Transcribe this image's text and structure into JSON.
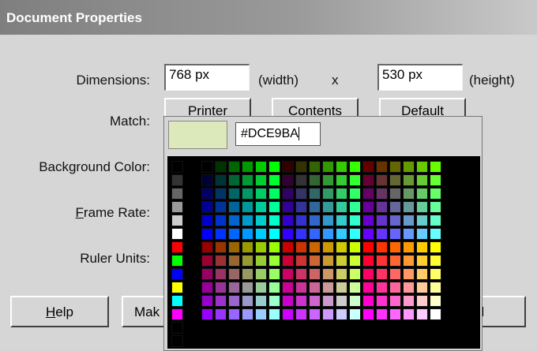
{
  "window": {
    "title": "Document Properties"
  },
  "dimensions": {
    "label": "Dimensions:",
    "width_value": "768 px",
    "width_unit": "(width)",
    "separator": "x",
    "height_value": "530 px",
    "height_unit": "(height)"
  },
  "match": {
    "label": "Match:",
    "printer_label": "Printer",
    "contents_label": "Contents",
    "default_label": "Default"
  },
  "background": {
    "label": "Background Color:"
  },
  "frame_rate": {
    "label_prefix": "",
    "label_underlined": "F",
    "label_rest": "rame Rate:"
  },
  "ruler_units": {
    "label": "Ruler Units:"
  },
  "buttons": {
    "help_underlined": "H",
    "help_rest": "elp",
    "make_default_partial": "Mak",
    "cancel_partial": "ncel"
  },
  "color_popup": {
    "hex_value": "#DCE9BA",
    "preview_color": "#DCE9BA"
  }
}
